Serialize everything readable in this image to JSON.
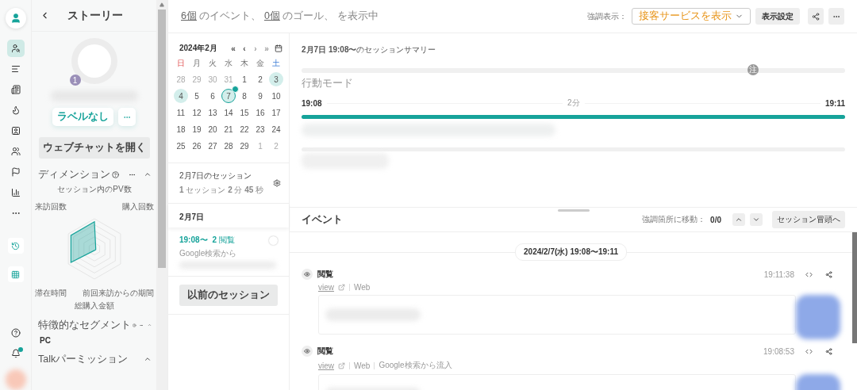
{
  "rail": {
    "nav_items": [
      {
        "selected": true
      },
      {
        "selected": false
      },
      {
        "selected": false
      },
      {
        "selected": false
      },
      {
        "selected": false
      },
      {
        "selected": false
      },
      {
        "selected": false
      },
      {
        "selected": false
      },
      {
        "selected": false
      }
    ],
    "notification_dot": true
  },
  "story": {
    "title": "ストーリー",
    "avatar_badge": "1",
    "label_button": "ラベルなし",
    "webchat_button": "ウェブチャットを開く",
    "dimension": {
      "title": "ディメンション",
      "axes": [
        "セッション内のPV数",
        "来訪回数",
        "購入回数",
        "滞在時間",
        "前回来訪からの期間",
        "総購入金額"
      ]
    },
    "segment": {
      "title": "特徴的なセグメント",
      "value": "PC"
    },
    "permission": {
      "title": "Talkパーミッション"
    }
  },
  "top_bar": {
    "events_count": "6個",
    "events_label": "のイベント、",
    "goals_count": "0個",
    "goals_label": "のゴール、 を表示中",
    "highlight_label": "強調表示：",
    "highlight_value": "接客サービスを表示",
    "settings_button": "表示設定"
  },
  "calendar": {
    "month": "2024年2月",
    "nav": [
      "«",
      "‹",
      "›",
      "»"
    ],
    "weekdays": [
      {
        "label": "日",
        "kind": "sunday"
      },
      {
        "label": "月",
        "kind": "weekday"
      },
      {
        "label": "火",
        "kind": "weekday"
      },
      {
        "label": "水",
        "kind": "weekday"
      },
      {
        "label": "木",
        "kind": "weekday"
      },
      {
        "label": "金",
        "kind": "weekday"
      },
      {
        "label": "土",
        "kind": "saturday"
      }
    ],
    "days": [
      {
        "label": "28",
        "muted": true,
        "highlighted": false,
        "selected": false
      },
      {
        "label": "29",
        "muted": true,
        "highlighted": false,
        "selected": false
      },
      {
        "label": "30",
        "muted": true,
        "highlighted": false,
        "selected": false
      },
      {
        "label": "31",
        "muted": true,
        "highlighted": false,
        "selected": false
      },
      {
        "label": "1",
        "muted": false,
        "highlighted": false,
        "selected": false
      },
      {
        "label": "2",
        "muted": false,
        "highlighted": false,
        "selected": false
      },
      {
        "label": "3",
        "muted": false,
        "highlighted": true,
        "selected": false
      },
      {
        "label": "4",
        "muted": false,
        "highlighted": true,
        "selected": false
      },
      {
        "label": "5",
        "muted": false,
        "highlighted": false,
        "selected": false
      },
      {
        "label": "6",
        "muted": false,
        "highlighted": false,
        "selected": false
      },
      {
        "label": "7",
        "muted": false,
        "highlighted": true,
        "selected": true
      },
      {
        "label": "8",
        "muted": false,
        "highlighted": false,
        "selected": false
      },
      {
        "label": "9",
        "muted": false,
        "highlighted": false,
        "selected": false
      },
      {
        "label": "10",
        "muted": false,
        "highlighted": false,
        "selected": false
      },
      {
        "label": "11",
        "muted": false,
        "highlighted": false,
        "selected": false
      },
      {
        "label": "12",
        "muted": false,
        "highlighted": false,
        "selected": false
      },
      {
        "label": "13",
        "muted": false,
        "highlighted": false,
        "selected": false
      },
      {
        "label": "14",
        "muted": false,
        "highlighted": false,
        "selected": false
      },
      {
        "label": "15",
        "muted": false,
        "highlighted": false,
        "selected": false
      },
      {
        "label": "16",
        "muted": false,
        "highlighted": false,
        "selected": false
      },
      {
        "label": "17",
        "muted": false,
        "highlighted": false,
        "selected": false
      },
      {
        "label": "18",
        "muted": false,
        "highlighted": false,
        "selected": false
      },
      {
        "label": "19",
        "muted": false,
        "highlighted": false,
        "selected": false
      },
      {
        "label": "20",
        "muted": false,
        "highlighted": false,
        "selected": false
      },
      {
        "label": "21",
        "muted": false,
        "highlighted": false,
        "selected": false
      },
      {
        "label": "22",
        "muted": false,
        "highlighted": false,
        "selected": false
      },
      {
        "label": "23",
        "muted": false,
        "highlighted": false,
        "selected": false
      },
      {
        "label": "24",
        "muted": false,
        "highlighted": false,
        "selected": false
      },
      {
        "label": "25",
        "muted": false,
        "highlighted": false,
        "selected": false
      },
      {
        "label": "26",
        "muted": false,
        "highlighted": false,
        "selected": false
      },
      {
        "label": "27",
        "muted": false,
        "highlighted": false,
        "selected": false
      },
      {
        "label": "28",
        "muted": false,
        "highlighted": false,
        "selected": false
      },
      {
        "label": "29",
        "muted": false,
        "highlighted": false,
        "selected": false
      },
      {
        "label": "1",
        "muted": true,
        "highlighted": false,
        "selected": false
      },
      {
        "label": "2",
        "muted": true,
        "highlighted": false,
        "selected": false
      }
    ]
  },
  "sessions": {
    "title": "2月7日のセッション",
    "stats": "**1** セッション  **2** 分 **45** 秒",
    "date_heading": "2月7日",
    "items": [
      {
        "time": "19:08〜",
        "views": "**2** 閲覧",
        "source": "Google検索から"
      }
    ],
    "previous_button": "以前のセッション"
  },
  "summary": {
    "title": "**2月7日 19:08〜**のセッションサマリー",
    "behavior_marker": {
      "label": "注",
      "level": 0.83
    },
    "behavior_label": "行動モード",
    "start": "19:08",
    "duration": "2分",
    "end": "19:11",
    "progress": {
      "level": 1
    }
  },
  "events": {
    "title": "イベント",
    "jump_label": "強調箇所に移動：",
    "jump_count": "0/0",
    "top_button": "セッション冒頭へ",
    "date_range": "2024/2/7(水) 19:08〜19:11",
    "items": [
      {
        "title": "閲覧",
        "time": "19:11:38",
        "link": "view",
        "channel": "Web"
      },
      {
        "title": "閲覧",
        "time": "19:08:53",
        "link": "view",
        "channel": "Web",
        "source": "Google検索から流入"
      }
    ]
  }
}
